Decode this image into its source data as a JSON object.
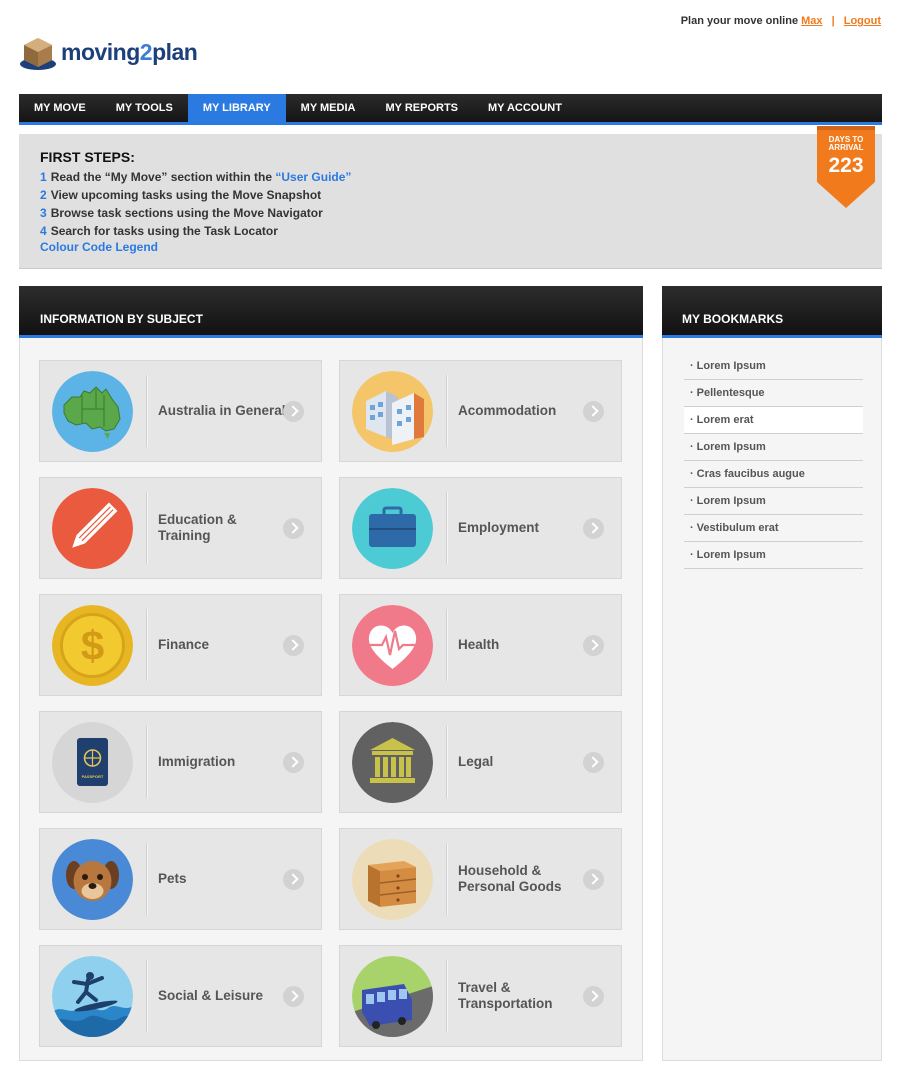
{
  "header": {
    "tagline": "Plan your move online",
    "user": "Max",
    "separator": "|",
    "logout": "Logout"
  },
  "logo": {
    "part1": "moving",
    "part2": "2",
    "part3": "plan"
  },
  "nav": [
    {
      "label": "MY MOVE"
    },
    {
      "label": "MY TOOLS"
    },
    {
      "label": "MY LIBRARY",
      "active": true
    },
    {
      "label": "MY MEDIA"
    },
    {
      "label": "MY REPORTS"
    },
    {
      "label": "MY ACCOUNT"
    }
  ],
  "first_steps": {
    "title": "FIRST STEPS:",
    "steps": [
      {
        "num": "1",
        "text": "Read the “My Move” section within the ",
        "link": "“User Guide”"
      },
      {
        "num": "2",
        "text": "View upcoming tasks using the Move Snapshot",
        "link": ""
      },
      {
        "num": "3",
        "text": "Browse task sections using the Move Navigator",
        "link": ""
      },
      {
        "num": "4",
        "text": "Search for tasks using the Task Locator",
        "link": ""
      }
    ],
    "legend": "Colour Code Legend"
  },
  "arrival": {
    "label_line1": "DAYS TO",
    "label_line2": "ARRIVAL",
    "days": "223",
    "color": "#f07a1c"
  },
  "info": {
    "title": "INFORMATION BY SUBJECT",
    "tiles": [
      {
        "label": "Australia in General",
        "icon": "australia-map-icon"
      },
      {
        "label": "Acommodation",
        "icon": "building-icon"
      },
      {
        "label": "Education & Training",
        "icon": "pencil-icon"
      },
      {
        "label": "Employment",
        "icon": "briefcase-icon"
      },
      {
        "label": "Finance",
        "icon": "dollar-coin-icon"
      },
      {
        "label": "Health",
        "icon": "heart-icon"
      },
      {
        "label": "Immigration",
        "icon": "passport-icon"
      },
      {
        "label": "Legal",
        "icon": "courthouse-icon"
      },
      {
        "label": "Pets",
        "icon": "dog-icon"
      },
      {
        "label": "Household & Personal Goods",
        "icon": "dresser-icon"
      },
      {
        "label": "Social & Leisure",
        "icon": "surfer-icon"
      },
      {
        "label": "Travel & Transportation",
        "icon": "bus-icon"
      }
    ],
    "passport_text": "PASSPORT"
  },
  "bookmarks": {
    "title": "MY BOOKMARKS",
    "items": [
      "Lorem Ipsum",
      "Pellentesque",
      "Lorem erat",
      "Lorem Ipsum",
      "Cras faucibus augue",
      "Lorem Ipsum",
      "Vestibulum erat",
      "Lorem Ipsum"
    ]
  }
}
